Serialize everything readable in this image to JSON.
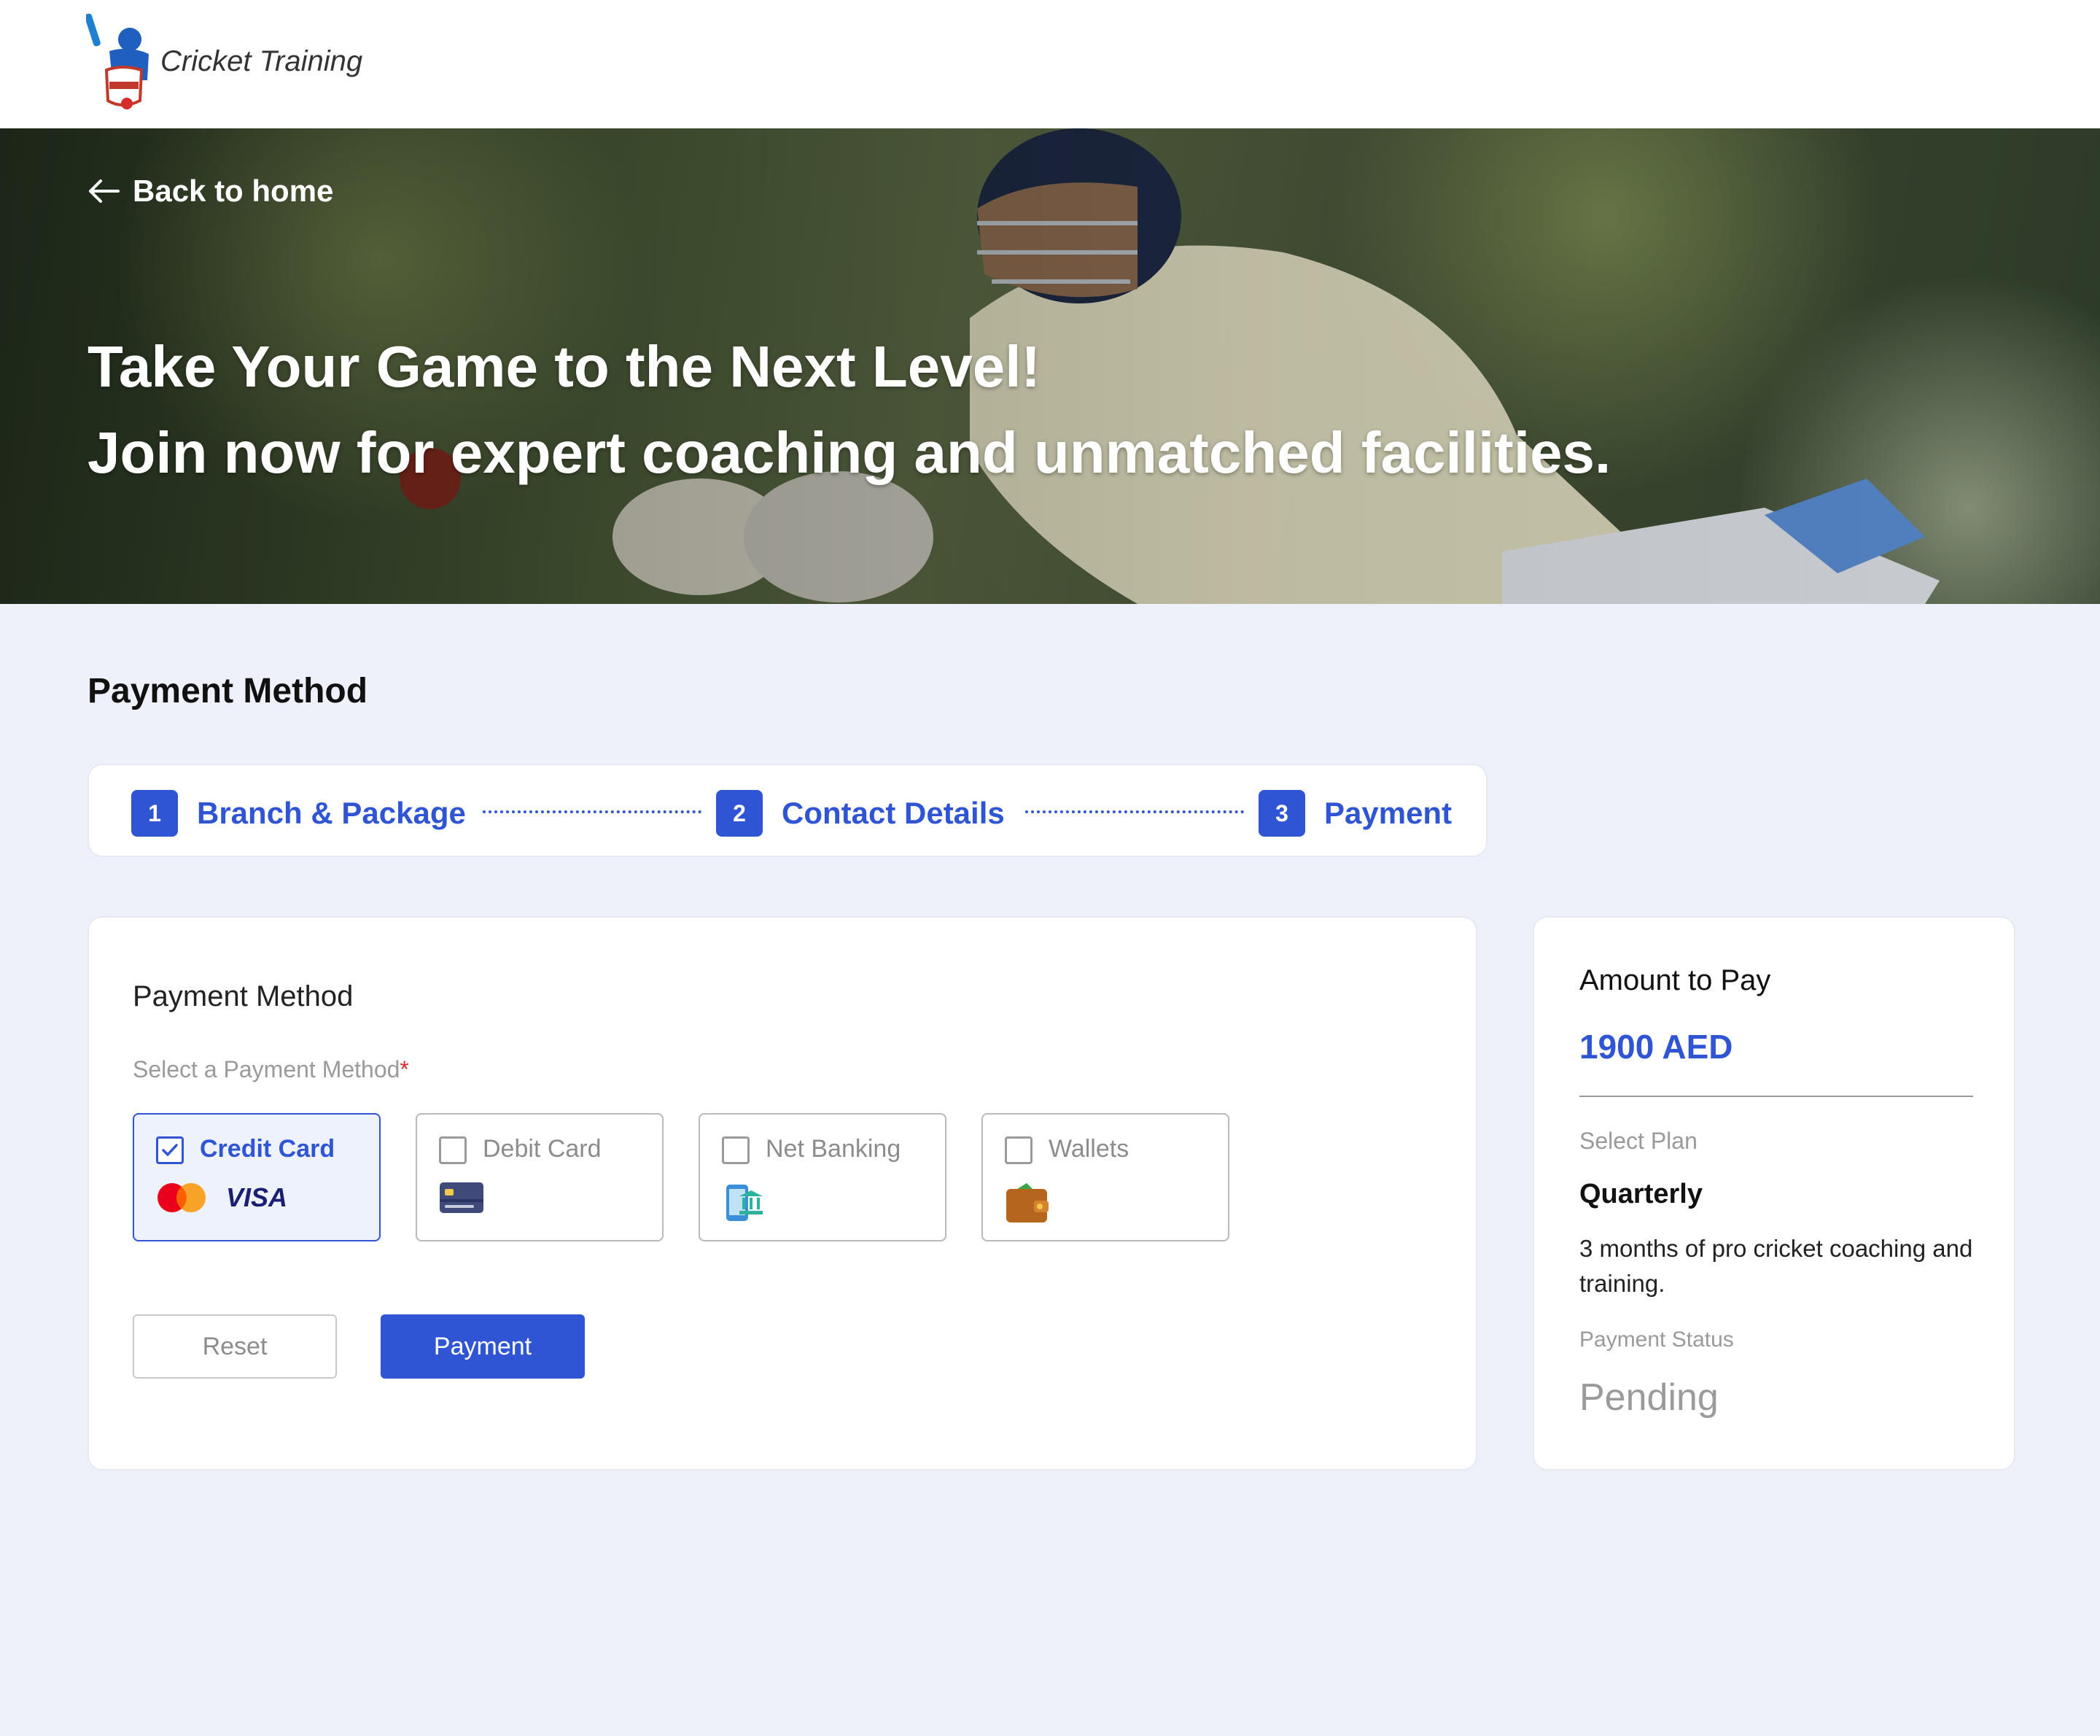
{
  "header": {
    "brand_name": "Cricket Training",
    "logo_icon": "cricket-academy-logo"
  },
  "hero": {
    "back_label": "Back to home",
    "title_line1": "Take Your Game to the Next Level!",
    "title_line2": "Join now for expert coaching and unmatched facilities."
  },
  "page": {
    "section_title": "Payment Method"
  },
  "stepper": {
    "steps": [
      {
        "number": "1",
        "label": "Branch & Package"
      },
      {
        "number": "2",
        "label": "Contact Details"
      },
      {
        "number": "3",
        "label": "Payment"
      }
    ]
  },
  "payment_form": {
    "heading": "Payment Method",
    "field_label": "Select a Payment Method",
    "required_mark": "*",
    "methods": [
      {
        "label": "Credit Card",
        "selected": true,
        "icon": "credit-card-brands-icon",
        "brand_text": "VISA"
      },
      {
        "label": "Debit Card",
        "selected": false,
        "icon": "debit-card-icon"
      },
      {
        "label": "Net Banking",
        "selected": false,
        "icon": "net-banking-icon"
      },
      {
        "label": "Wallets",
        "selected": false,
        "icon": "wallet-icon"
      }
    ],
    "reset_label": "Reset",
    "pay_label": "Payment"
  },
  "summary": {
    "title": "Amount to Pay",
    "amount": "1900 AED",
    "plan_label": "Select Plan",
    "plan_name": "Quarterly",
    "plan_description": "3 months of pro cricket coaching and training.",
    "status_label": "Payment Status",
    "status_value": "Pending"
  },
  "colors": {
    "accent": "#2f55d4",
    "page_background": "#eef1fa",
    "muted_text": "#9a9a9a"
  }
}
